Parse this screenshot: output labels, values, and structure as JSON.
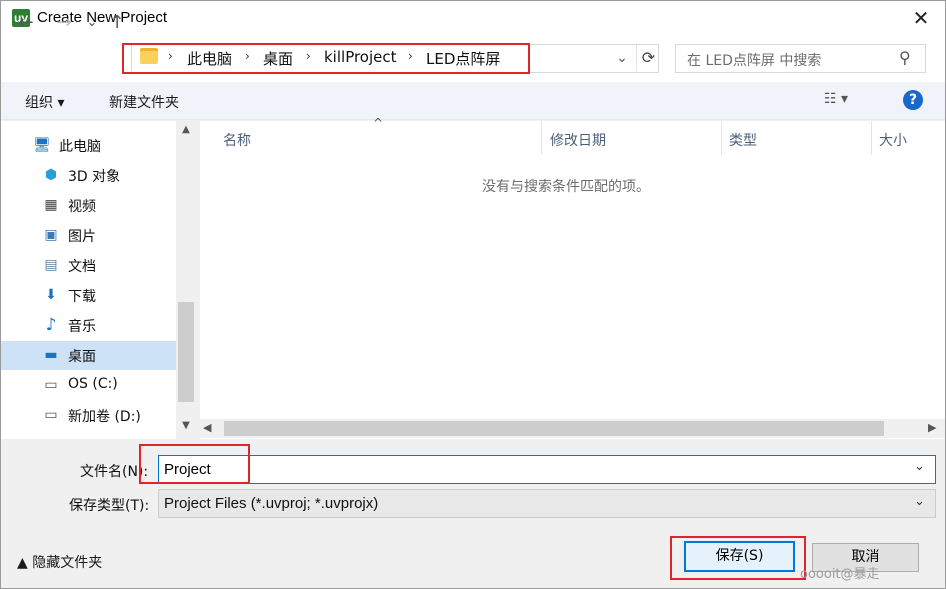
{
  "window": {
    "title": "Create New Project",
    "app_icon": "uv",
    "close_glyph": "✕"
  },
  "nav": {
    "back_glyph": "←",
    "forward_glyph": "→",
    "history_glyph": "⌄",
    "up_glyph": "↑",
    "breadcrumbs": [
      "此电脑",
      "桌面",
      "killProject",
      "LED点阵屏"
    ],
    "separator": "›",
    "search_placeholder": "在 LED点阵屏 中搜索"
  },
  "toolbar": {
    "organize_label": "组织 ▾",
    "new_folder_label": "新建文件夹",
    "view_glyph": "☷ ▾",
    "help_glyph": "?"
  },
  "sidebar": {
    "items": [
      {
        "label": "此电脑",
        "icon": "computer-icon",
        "glyph": "🖥"
      },
      {
        "label": "3D 对象",
        "icon": "cube-icon",
        "glyph": "⬢"
      },
      {
        "label": "视频",
        "icon": "film-icon",
        "glyph": "▦"
      },
      {
        "label": "图片",
        "icon": "picture-icon",
        "glyph": "▣"
      },
      {
        "label": "文档",
        "icon": "document-icon",
        "glyph": "▤"
      },
      {
        "label": "下载",
        "icon": "download-icon",
        "glyph": "⬇"
      },
      {
        "label": "音乐",
        "icon": "music-icon",
        "glyph": "♪"
      },
      {
        "label": "桌面",
        "icon": "desktop-icon",
        "glyph": "▬"
      },
      {
        "label": "OS (C:)",
        "icon": "drive-icon",
        "glyph": "▭"
      },
      {
        "label": "新加卷 (D:)",
        "icon": "drive-icon",
        "glyph": "▭"
      }
    ],
    "selected_index": 7
  },
  "filelist": {
    "columns": [
      "名称",
      "修改日期",
      "类型",
      "大小"
    ],
    "sort_glyph": "^",
    "empty_message": "没有与搜索条件匹配的项。"
  },
  "form": {
    "filename_label": "文件名(N):",
    "filename_value": "Project",
    "filetype_label": "保存类型(T):",
    "filetype_value": "Project Files (*.uvproj; *.uvprojx)",
    "dropdown_glyph": "⌄"
  },
  "footer": {
    "hide_folders_label": "▲ 隐藏文件夹",
    "save_label": "保存(S)",
    "cancel_label": "取消",
    "watermark": "ooooit@暴走"
  },
  "colors": {
    "highlight": "#e0242e",
    "accent": "#0078d7",
    "selected": "#cde1f7"
  }
}
